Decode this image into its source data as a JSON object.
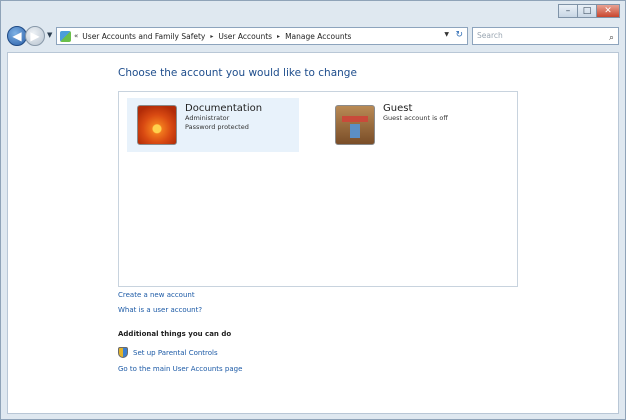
{
  "window": {
    "minimize_glyph": "–",
    "maximize_glyph": "□",
    "close_glyph": "✕"
  },
  "address_bar": {
    "chevron": "«",
    "breadcrumbs": [
      "User Accounts and Family Safety",
      "User Accounts",
      "Manage Accounts"
    ],
    "separator": "▸",
    "search_placeholder": "Search"
  },
  "main": {
    "heading": "Choose the account you would like to change",
    "accounts": [
      {
        "name": "Documentation",
        "details": [
          "Administrator",
          "Password protected"
        ],
        "picture_icon": "flower-icon",
        "selected": true
      },
      {
        "name": "Guest",
        "details": [
          "Guest account is off"
        ],
        "picture_icon": "chest-icon",
        "selected": false
      }
    ],
    "links": {
      "create_account": "Create a new account",
      "what_is_account": "What is a user account?"
    },
    "additional": {
      "title": "Additional things you can do",
      "parental_controls": "Set up Parental Controls",
      "main_page": "Go to the main User Accounts page"
    }
  },
  "colors": {
    "link": "#1c5aa6",
    "heading": "#1e4d8c",
    "selected_bg": "#e8f2fb"
  }
}
